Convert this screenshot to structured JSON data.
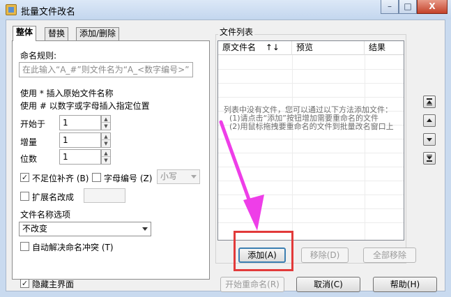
{
  "window": {
    "title": "批量文件改名",
    "controls": {
      "minimize": "–",
      "maximize": "□",
      "close": "X"
    }
  },
  "tabs": [
    {
      "label": "整体",
      "active": true
    },
    {
      "label": "替换",
      "active": false
    },
    {
      "label": "添加/删除",
      "active": false
    }
  ],
  "naming": {
    "rule_label": "命名规则:",
    "rule_placeholder": "在此输入“A_#”则文件名为“A_<数字编号>”",
    "hint_star": "使用 * 插入原始文件名称",
    "hint_hash": "使用 # 以数字或字母插入指定位置"
  },
  "numbers": {
    "start_label": "开始于",
    "start_value": "1",
    "step_label": "增量",
    "step_value": "1",
    "digits_label": "位数",
    "digits_value": "1"
  },
  "options": {
    "pad_zero": {
      "label": "不足位补齐",
      "shortcut": "(B)",
      "checked": true
    },
    "letter_number": {
      "label": "字母编号",
      "shortcut": "(Z)",
      "checked": false
    },
    "letter_case": "小写",
    "ext_change": {
      "label": "扩展名改成",
      "checked": false
    },
    "name_option_label": "文件名称选项",
    "name_option_value": "不改变",
    "auto_conflict": {
      "label": "自动解决命名冲突",
      "shortcut": "(T)",
      "checked": false
    }
  },
  "file_list": {
    "group_title": "文件列表",
    "columns": [
      "原文件名",
      "预览",
      "结果"
    ],
    "sort_icon": "↑↓",
    "empty_message": [
      "列表中没有文件，您可以通过以下方法添加文件：",
      "(1)请点击“添加”按钮增加需要重命名的文件",
      "(2)用鼠标拖拽要重命名的文件到批量改名窗口上"
    ],
    "buttons": {
      "add": "添加(A)",
      "remove": "移除(D)",
      "remove_all": "全部移除"
    }
  },
  "footer": {
    "hide_main": {
      "label": "隐藏主界面",
      "checked": true
    },
    "start": "开始重命名(R)",
    "cancel": "取消(C)",
    "help": "帮助(H)"
  },
  "annotation_color": "#e23a3a",
  "arrow_color": "#ee3ee8"
}
